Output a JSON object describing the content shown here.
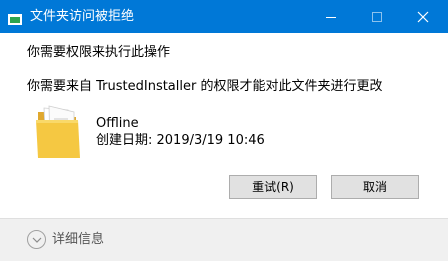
{
  "window": {
    "title": "文件夹访问被拒绝",
    "icons": {
      "app": "folder-icon",
      "minimize": "minimize-icon",
      "maximize": "maximize-icon",
      "close": "close-icon"
    }
  },
  "dialog": {
    "heading": "你需要权限来执行此操作",
    "message": "你需要来自 TrustedInstaller 的权限才能对此文件夹进行更改",
    "item": {
      "name": "Offline",
      "date_label": "创建日期: 2019/3/19 10:46",
      "icon": "folder-icon"
    },
    "buttons": {
      "retry": "重试(R)",
      "cancel": "取消"
    }
  },
  "footer": {
    "details_label": "详细信息",
    "details_icon": "chevron-down-icon"
  },
  "colors": {
    "titlebar": "#0078d7",
    "folder": "#f5c842",
    "button": "#e1e1e1",
    "footer": "#f0f0f0"
  }
}
